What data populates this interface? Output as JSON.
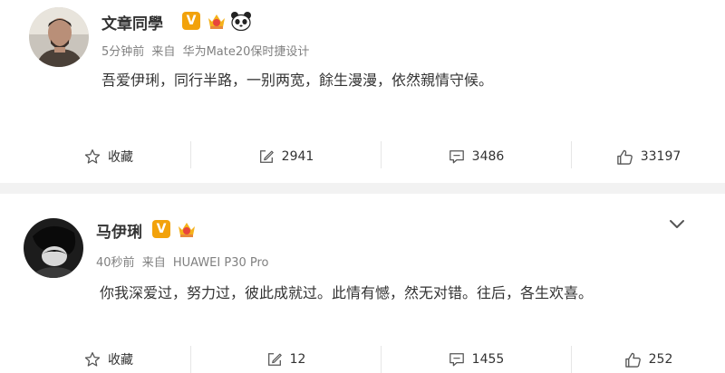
{
  "posts": [
    {
      "username": "文章同學",
      "meta": {
        "time": "5分钟前",
        "source_prefix": "来自",
        "device": "华为Mate20保时捷设计"
      },
      "content": "吾爱伊琍，同行半路，一别两宽，餘生漫漫，依然親情守候。",
      "actions": {
        "favorite": "收藏",
        "repost": "2941",
        "comment": "3486",
        "like": "33197"
      }
    },
    {
      "username": "马伊琍",
      "meta": {
        "time": "40秒前",
        "source_prefix": "来自",
        "device": "HUAWEI P30 Pro"
      },
      "content": "你我深爱过，努力过，彼此成就过。此情有憾，然无对错。往后，各生欢喜。",
      "actions": {
        "favorite": "收藏",
        "repost": "12",
        "comment": "1455",
        "like": "252"
      }
    }
  ],
  "colors": {
    "verified_badge": "#f2a20b",
    "meta_text": "#808080",
    "separator": "#f2f2f2"
  },
  "icons": [
    "star-outline-icon",
    "repost-edit-icon",
    "comment-bubble-icon",
    "thumbs-up-icon",
    "chevron-down-icon",
    "crown-badge-icon",
    "panda-badge-icon"
  ]
}
